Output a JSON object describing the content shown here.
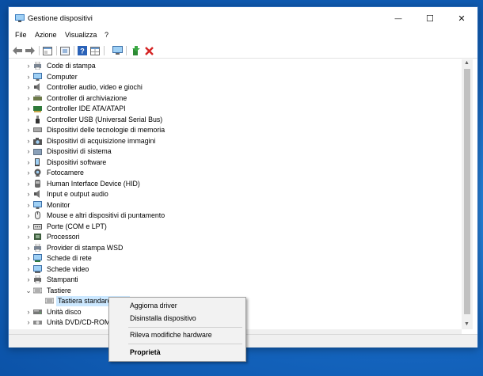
{
  "window": {
    "title": "Gestione dispositivi",
    "controls": {
      "minimize": "—",
      "maximize": "☐",
      "close": "✕"
    }
  },
  "menu": {
    "items": [
      "File",
      "Azione",
      "Visualizza",
      "?"
    ]
  },
  "toolbar": {
    "icons": [
      "back-arrow-icon",
      "forward-arrow-icon",
      "properties-window-icon",
      "update-driver-icon",
      "help-icon",
      "grid-view-icon",
      "monitor-scan-icon",
      "add-driver-icon",
      "remove-red-x-icon"
    ]
  },
  "tree": {
    "items": [
      {
        "label": "Code di stampa",
        "icon": "printer-queue-icon",
        "expander": "›"
      },
      {
        "label": "Computer",
        "icon": "computer-icon",
        "expander": "›"
      },
      {
        "label": "Controller audio, video e giochi",
        "icon": "speaker-icon",
        "expander": "›"
      },
      {
        "label": "Controller di archiviazione",
        "icon": "storage-controller-icon",
        "expander": "›"
      },
      {
        "label": "Controller IDE ATA/ATAPI",
        "icon": "ide-controller-icon",
        "expander": "›"
      },
      {
        "label": "Controller USB (Universal Serial Bus)",
        "icon": "usb-icon",
        "expander": "›"
      },
      {
        "label": "Dispositivi delle tecnologie di memoria",
        "icon": "memory-icon",
        "expander": "›"
      },
      {
        "label": "Dispositivi di acquisizione immagini",
        "icon": "camera-icon",
        "expander": "›"
      },
      {
        "label": "Dispositivi di sistema",
        "icon": "system-folder-icon",
        "expander": "›"
      },
      {
        "label": "Dispositivi software",
        "icon": "software-device-icon",
        "expander": "›"
      },
      {
        "label": "Fotocamere",
        "icon": "webcam-icon",
        "expander": "›"
      },
      {
        "label": "Human Interface Device (HID)",
        "icon": "hid-icon",
        "expander": "›"
      },
      {
        "label": "Input e output audio",
        "icon": "speaker-icon",
        "expander": "›"
      },
      {
        "label": "Monitor",
        "icon": "monitor-icon",
        "expander": "›"
      },
      {
        "label": "Mouse e altri dispositivi di puntamento",
        "icon": "mouse-icon",
        "expander": "›"
      },
      {
        "label": "Porte (COM e LPT)",
        "icon": "port-icon",
        "expander": "›"
      },
      {
        "label": "Processori",
        "icon": "processor-icon",
        "expander": "›"
      },
      {
        "label": "Provider di stampa WSD",
        "icon": "wsd-printer-icon",
        "expander": "›"
      },
      {
        "label": "Schede di rete",
        "icon": "network-adapter-icon",
        "expander": "›"
      },
      {
        "label": "Schede video",
        "icon": "display-adapter-icon",
        "expander": "›"
      },
      {
        "label": "Stampanti",
        "icon": "printer-icon",
        "expander": "›"
      },
      {
        "label": "Tastiere",
        "icon": "keyboard-icon",
        "expander": "⌄"
      },
      {
        "label": "Tastiera standard PS/2",
        "icon": "keyboard-icon",
        "expander": "",
        "child": true,
        "selected": true
      },
      {
        "label": "Unità disco",
        "icon": "disk-drive-icon",
        "expander": "›"
      },
      {
        "label": "Unità DVD/CD-ROM",
        "icon": "dvd-drive-icon",
        "expander": "›"
      }
    ]
  },
  "context_menu": {
    "items": [
      {
        "label": "Aggiorna driver"
      },
      {
        "label": "Disinstalla dispositivo"
      },
      {
        "label": "Rileva modifiche hardware"
      },
      {
        "label": "Proprietà",
        "bold": true
      }
    ]
  }
}
